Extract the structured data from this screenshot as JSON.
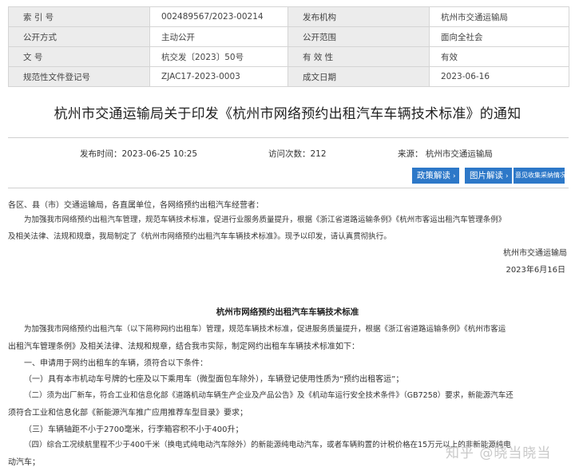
{
  "meta": {
    "rows": [
      {
        "k1": "索 引 号",
        "v1": "002489567/2023-00214",
        "k2": "发布机构",
        "v2": "杭州市交通运输局"
      },
      {
        "k1": "公开方式",
        "v1": "主动公开",
        "k2": "公开范围",
        "v2": "面向全社会"
      },
      {
        "k1": "文 号",
        "v1": "杭交发〔2023〕50号",
        "k2": "有 效 性",
        "v2": "有效"
      },
      {
        "k1": "规范性文件登记号",
        "v1": "ZJAC17-2023-0003",
        "k2": "成文日期",
        "v2": "2023-06-16"
      }
    ]
  },
  "title": "杭州市交通运输局关于印发《杭州市网络预约出租汽车车辆技术标准》的通知",
  "info": {
    "publish": "发布时间：2023-06-25 10:25",
    "visits": "访问次数：212",
    "source": "来源：  杭州市交通运输局"
  },
  "buttons": {
    "policy": "政策解读",
    "image": "图片解读",
    "feedback": "意见收集采纳情况"
  },
  "letter": {
    "salutation": "各区、县（市）交通运输局，各直属单位，各网络预约出租汽车经营者：",
    "body_line1": "为加强我市网络预约出租汽车管理，规范车辆技术标准，促进行业服务质量提升，根据《浙江省道路运输条例》《杭州市客运出租汽车管理条例》",
    "body_line2": "及相关法律、法规和规章，我局制定了《杭州市网络预约出租汽车车辆技术标准》。现予以印发，请认真贯彻执行。",
    "signature": "杭州市交通运输局",
    "date": "2023年6月16日"
  },
  "standard": {
    "title": "杭州市网络预约出租汽车车辆技术标准",
    "lines": [
      "为加强我市网络预约出租汽车（以下简称网约出租车）管理，规范车辆技术标准，促进服务质量提升，根据《浙江省道路运输条例》《杭州市客运",
      "出租汽车管理条例》及相关法律、法规和规章，结合我市实际，制定网约出租车车辆技术标准如下：",
      "一、申请用于网约出租车的车辆，须符合以下条件：",
      "（一）具有本市机动车号牌的七座及以下乘用车（微型面包车除外），车辆登记使用性质为“预约出租客运”；",
      "（二）须为出厂新车，符合工业和信息化部《道路机动车辆生产企业及产品公告》及《机动车运行安全技术条件》（GB7258）要求，新能源汽车还",
      "须符合工业和信息化部《新能源汽车推广应用推荐车型目录》要求；",
      "（三）车辆轴距不小于2700毫米，行李箱容积不小于400升；",
      "（四）综合工况续航里程不少于400千米（换电式纯电动汽车除外）的新能源纯电动汽车，或者车辆购置的计税价格在15万元以上的非新能源纯电",
      "动汽车；"
    ]
  },
  "watermark": "知乎 @晓当晓当"
}
